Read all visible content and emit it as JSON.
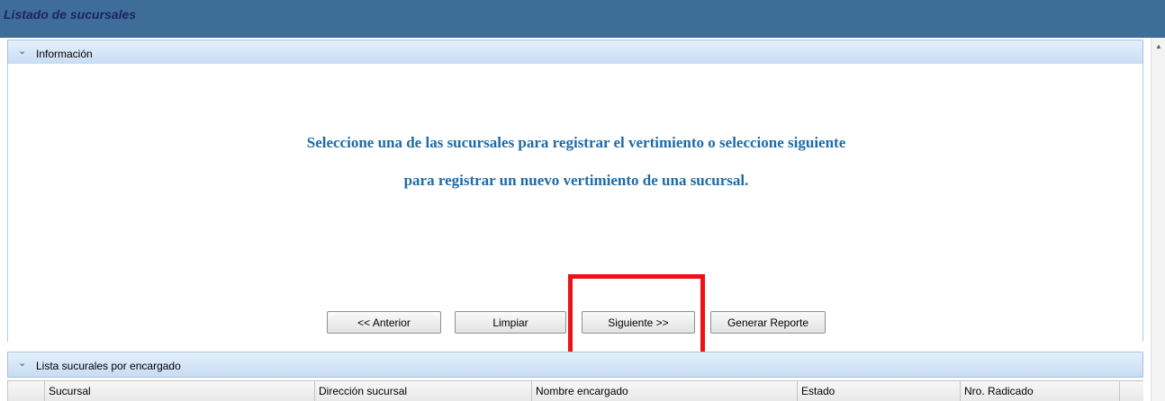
{
  "window": {
    "title": "Listado de sucursales"
  },
  "info_section": {
    "header": "Información",
    "message_line1": "Seleccione una de las sucursales para registrar el vertimiento o seleccione siguiente",
    "message_line2": "para registrar un nuevo vertimiento de una sucursal."
  },
  "buttons": {
    "previous": "<< Anterior",
    "clear": "Limpiar",
    "next": "Siguiente >>",
    "report": "Generar Reporte"
  },
  "list_section": {
    "header": "Lista sucurales por encargado",
    "columns": [
      "Sucursal",
      "Dirección sucursal",
      "Nombre encargado",
      "Estado",
      "Nro. Radicado"
    ]
  },
  "colors": {
    "title_bar": "#3f6d9a",
    "message_text": "#1d6ba9",
    "highlight": "#ea1216"
  }
}
